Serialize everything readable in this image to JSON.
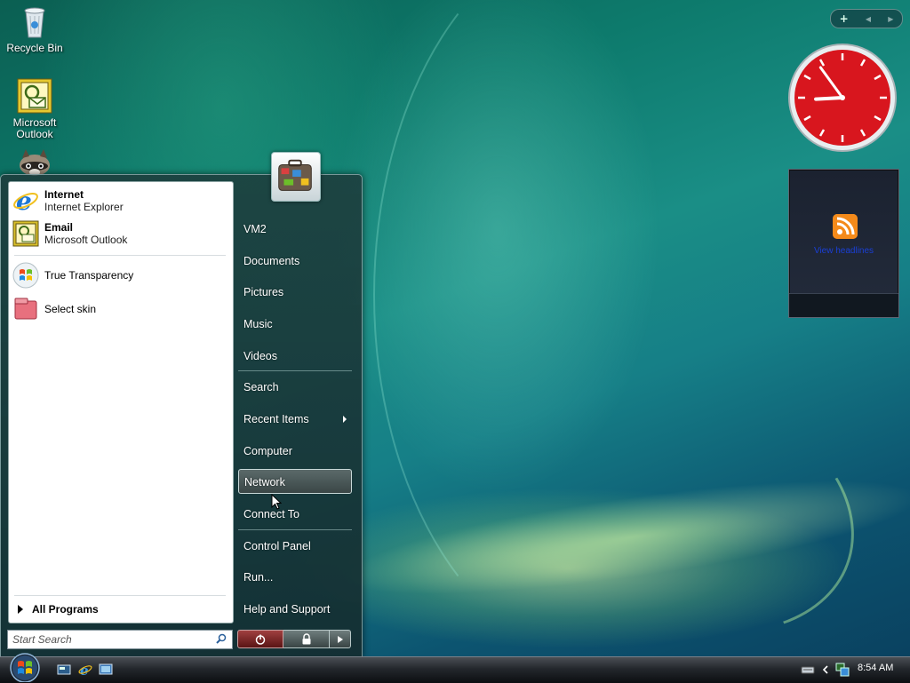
{
  "desktop": {
    "icons": [
      {
        "label": "Recycle Bin",
        "icon": "recycle-bin-icon"
      },
      {
        "label": "Microsoft Outlook",
        "line1": "Microsoft",
        "line2": "Outlook",
        "icon": "outlook-icon"
      },
      {
        "label": "",
        "icon": "raccoon-icon"
      }
    ]
  },
  "gadgets": {
    "toolbar": {
      "add": "+",
      "prev": "◀",
      "next": "▶"
    },
    "clock": {
      "hour": 8,
      "minute": 54,
      "face_color": "#d8161e"
    },
    "feed": {
      "icon": "rss-icon",
      "label": "View headlines"
    }
  },
  "start_menu": {
    "pinned": [
      {
        "title": "Internet",
        "subtitle": "Internet Explorer",
        "icon": "internet-explorer-icon"
      },
      {
        "title": "Email",
        "subtitle": "Microsoft Outlook",
        "icon": "outlook-icon"
      }
    ],
    "recent": [
      {
        "label": "True Transparency",
        "icon": "windows-logo-icon"
      },
      {
        "label": "Select skin",
        "icon": "skin-icon"
      }
    ],
    "all_programs": "All Programs",
    "search_placeholder": "Start Search",
    "right_items": [
      {
        "label": "VM2"
      },
      {
        "label": "Documents"
      },
      {
        "label": "Pictures"
      },
      {
        "label": "Music"
      },
      {
        "label": "Videos"
      },
      {
        "label": "Search"
      },
      {
        "label": "Recent Items",
        "has_submenu": true
      },
      {
        "label": "Computer"
      },
      {
        "label": "Network",
        "highlighted": true
      },
      {
        "label": "Connect To"
      },
      {
        "label": "Control Panel"
      },
      {
        "label": "Run..."
      },
      {
        "label": "Help and Support"
      }
    ],
    "user_picture": "suitcase-icon"
  },
  "taskbar": {
    "start": "windows-orb-icon",
    "quick_launch": [
      "show-desktop-icon",
      "internet-explorer-icon",
      "switch-windows-icon"
    ],
    "tray_icons": [
      "keyboard-icon",
      "chevron-left-icon",
      "network-icon"
    ],
    "time": "8:54 AM"
  }
}
